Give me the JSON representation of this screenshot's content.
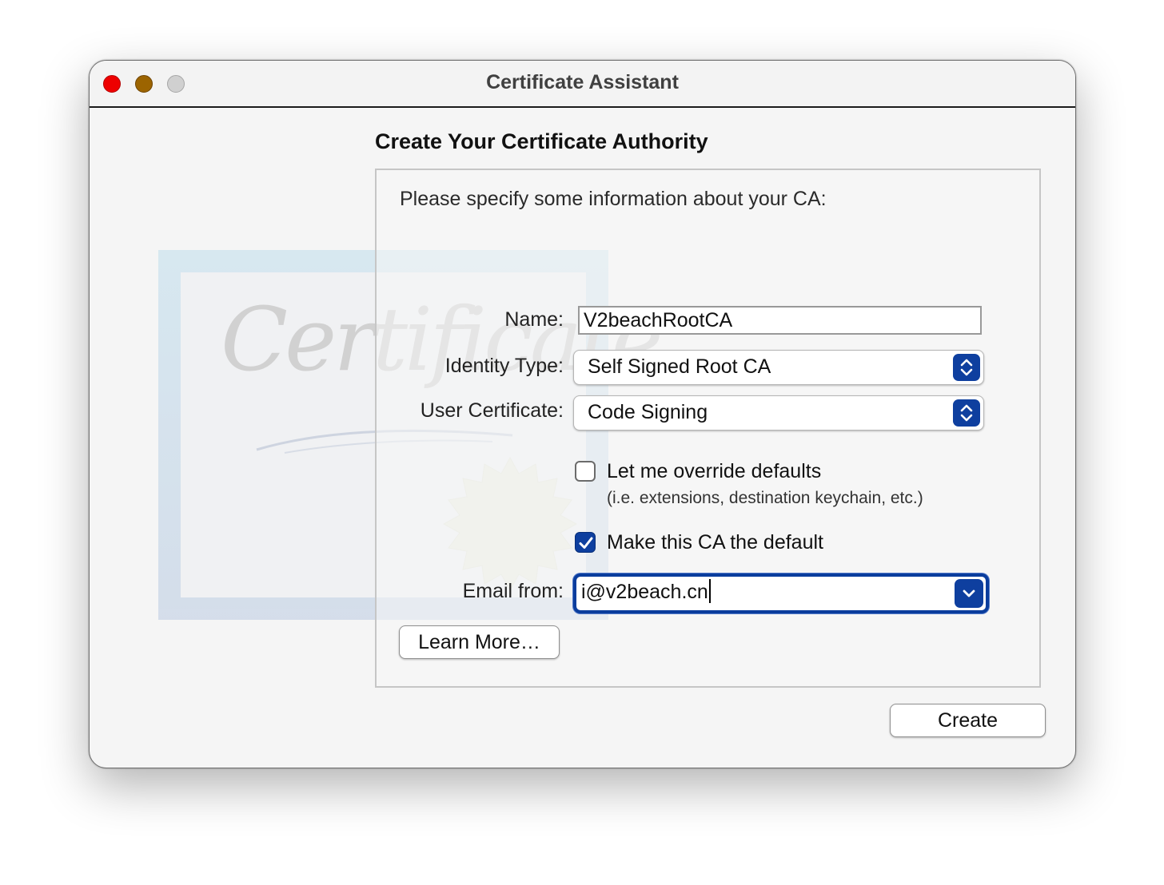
{
  "window": {
    "title": "Certificate Assistant"
  },
  "page": {
    "heading": "Create Your Certificate Authority",
    "instructions": "Please specify some information about your CA:"
  },
  "background": {
    "watermark_text": "Certificate"
  },
  "form": {
    "name_label": "Name:",
    "name_value": "V2beachRootCA",
    "identity_type_label": "Identity Type:",
    "identity_type_value": "Self Signed Root CA",
    "user_certificate_label": "User Certificate:",
    "user_certificate_value": "Code Signing",
    "override_label": "Let me override defaults",
    "override_hint": "(i.e. extensions, destination keychain, etc.)",
    "override_checked": false,
    "default_ca_label": "Make this CA the default",
    "default_ca_checked": true,
    "email_label": "Email from:",
    "email_value": "i@v2beach.cn"
  },
  "buttons": {
    "learn_more": "Learn More…",
    "create": "Create"
  },
  "colors": {
    "accent": "#0e3f9f",
    "close": "#ee0000",
    "minimize": "#9c6400",
    "zoom_inactive": "#d0d0d0"
  },
  "icons": {
    "popup_arrows": "chevron-up-down-icon",
    "combo_arrow": "chevron-down-icon",
    "checkmark": "checkmark-icon"
  }
}
